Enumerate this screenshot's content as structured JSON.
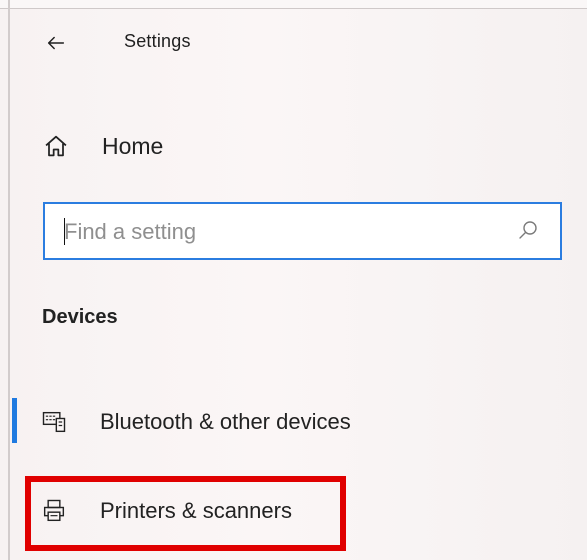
{
  "header": {
    "title": "Settings",
    "back_icon": "arrow-left-icon"
  },
  "home": {
    "label": "Home",
    "icon": "home-icon"
  },
  "search": {
    "placeholder": "Find a setting",
    "value": "",
    "icon": "search-icon"
  },
  "section": {
    "heading": "Devices"
  },
  "nav": {
    "items": [
      {
        "label": "Bluetooth & other devices",
        "icon": "keyboard-device-icon",
        "selected": true
      },
      {
        "label": "Printers & scanners",
        "icon": "printer-icon",
        "highlighted": true
      }
    ]
  },
  "colors": {
    "accent": "#1f7ae0",
    "highlight": "#e00000",
    "background": "#fbf6f6"
  }
}
